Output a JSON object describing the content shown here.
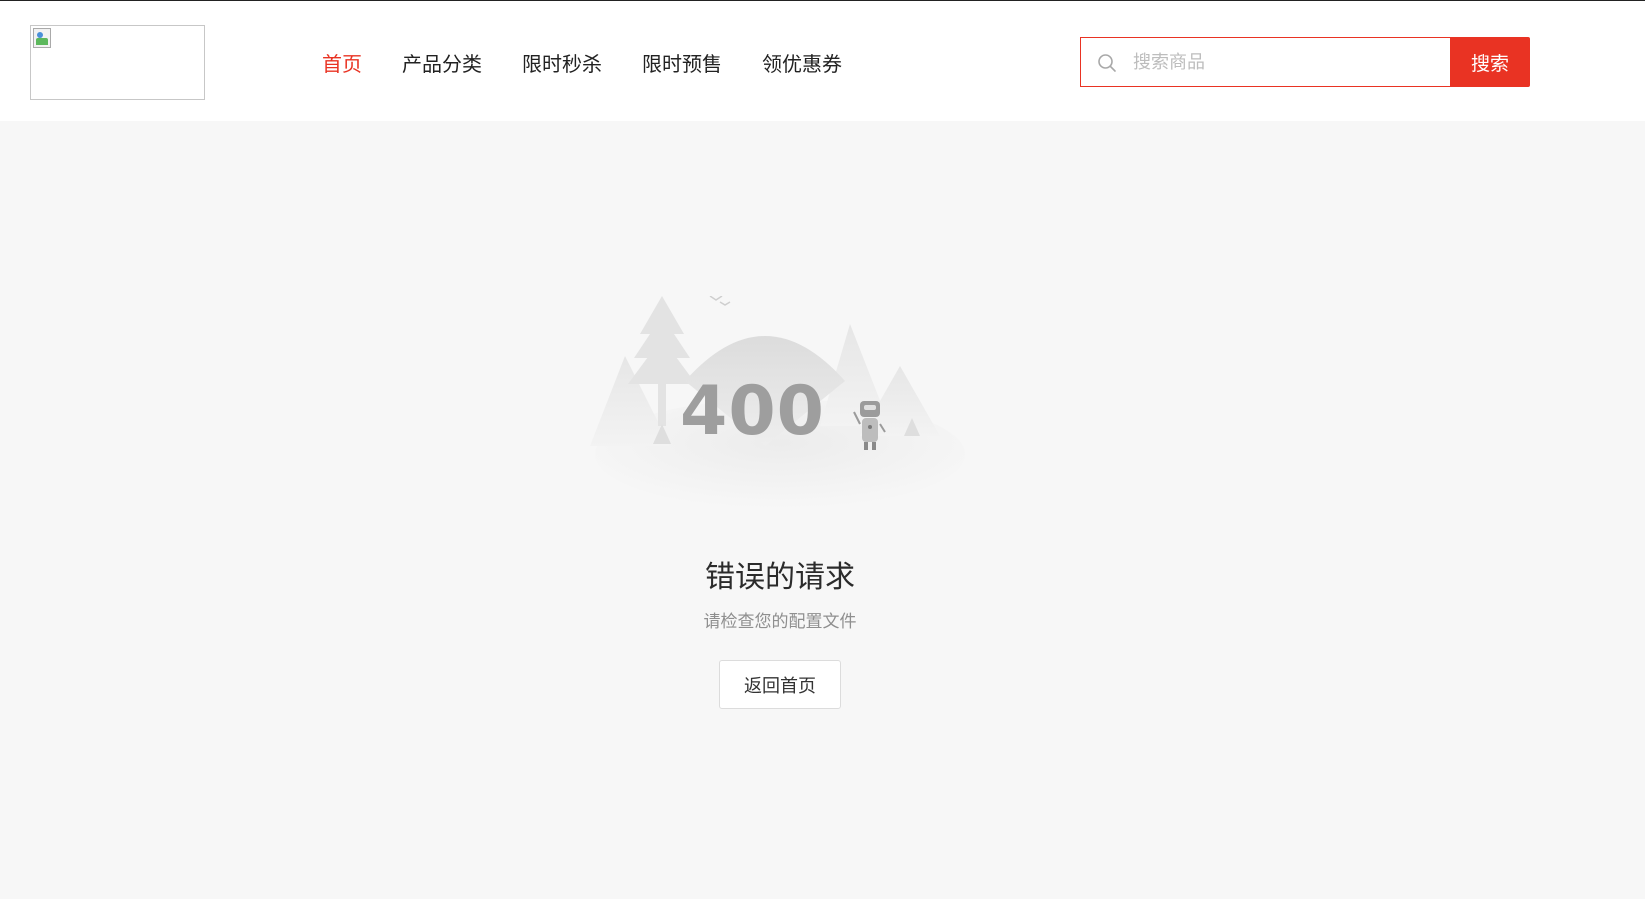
{
  "header": {
    "nav": [
      {
        "label": "首页",
        "active": true
      },
      {
        "label": "产品分类",
        "active": false
      },
      {
        "label": "限时秒杀",
        "active": false
      },
      {
        "label": "限时预售",
        "active": false
      },
      {
        "label": "领优惠券",
        "active": false
      }
    ],
    "search": {
      "placeholder": "搜索商品",
      "button_label": "搜索"
    }
  },
  "error": {
    "code": "400",
    "title": "错误的请求",
    "subtitle": "请检查您的配置文件",
    "back_label": "返回首页"
  },
  "colors": {
    "accent": "#e93323",
    "background": "#f7f7f7"
  }
}
